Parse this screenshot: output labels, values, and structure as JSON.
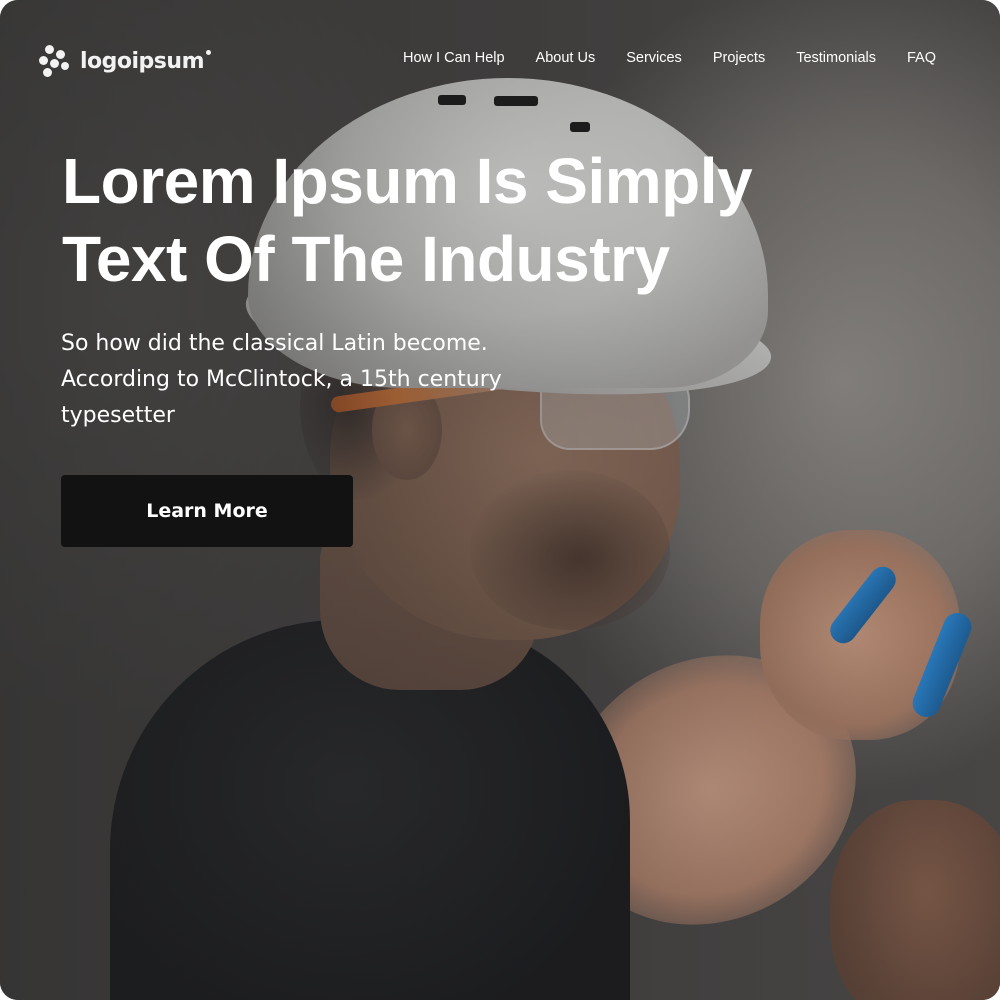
{
  "brand": {
    "logo_text": "logoipsum"
  },
  "nav": {
    "items": [
      {
        "label": "How I Can Help"
      },
      {
        "label": "About Us"
      },
      {
        "label": "Services"
      },
      {
        "label": "Projects"
      },
      {
        "label": "Testimonials"
      },
      {
        "label": "FAQ"
      }
    ]
  },
  "hero": {
    "headline_line1": "Lorem Ipsum Is Simply",
    "headline_line2": "Text Of The Industry",
    "subtext_line1": "So how did the classical Latin become.",
    "subtext_line2": "According to McClintock, a 15th century",
    "subtext_line3": "typesetter",
    "cta_label": "Learn More",
    "image_icon": "construction-worker-photo"
  },
  "colors": {
    "text": "#ffffff",
    "button_bg": "#121212",
    "overlay": "#1e1e1e"
  }
}
